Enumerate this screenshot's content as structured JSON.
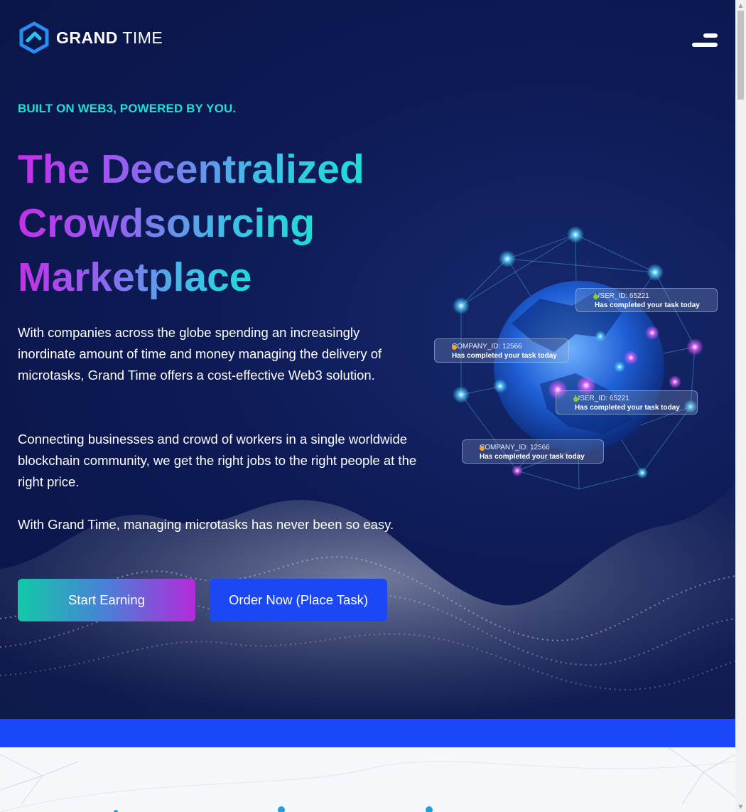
{
  "brand": {
    "name_bold": "GRAND",
    "name_light": "TIME"
  },
  "nav": {
    "menu_icon": "hamburger-menu-icon"
  },
  "hero": {
    "tagline": "BUILT ON WEB3, POWERED BY YOU.",
    "headline": [
      "The Decentralized",
      "Crowdsourcing",
      "Marketplace"
    ],
    "paragraphs": [
      "With companies across the globe spending an increasingly inordinate amount of time and money managing the delivery of microtasks, Grand Time offers a cost-effective Web3 solution.",
      "Connecting businesses and crowd of workers in a single worldwide blockchain community, we get the right jobs to the right people at the right price.",
      "With Grand Time, managing microtasks has never been so easy."
    ],
    "buttons": {
      "start": "Start Earning",
      "order": "Order Now (Place Task)"
    }
  },
  "notifications": [
    {
      "id": "USER_ID: 65221",
      "message": "Has completed your task today",
      "dot_color": "#7ed321"
    },
    {
      "id": "COMPANY_ID: 12566",
      "message": "Has completed your task today",
      "dot_color": "#f5a623"
    },
    {
      "id": "USER_ID: 65221",
      "message": "Has completed your task today",
      "dot_color": "#7ed321"
    },
    {
      "id": "COMPANY_ID: 12566",
      "message": "Has completed your task today",
      "dot_color": "#f5a623"
    }
  ],
  "colors": {
    "background": "#0a1446",
    "accent_teal": "#1de0d2",
    "accent_purple": "#c42fe8",
    "button_blue": "#1b47f5",
    "strip_blue": "#1b47fb"
  }
}
